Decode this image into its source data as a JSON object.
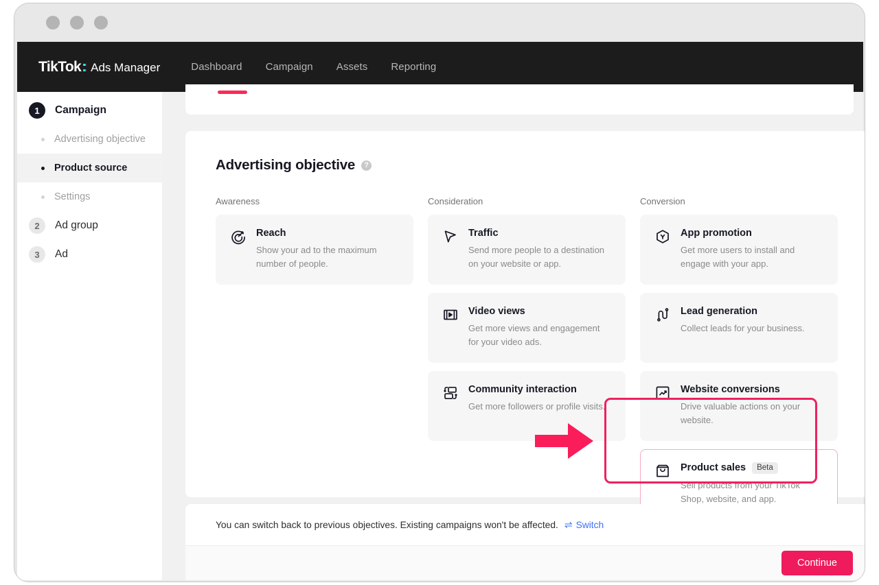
{
  "window": {
    "dots": [
      "close-dot",
      "minimize-dot",
      "maximize-dot"
    ]
  },
  "header": {
    "logo": "TikTok",
    "logo_colon": ":",
    "logo_suffix": "Ads Manager",
    "nav": [
      {
        "label": "Dashboard"
      },
      {
        "label": "Campaign"
      },
      {
        "label": "Assets"
      },
      {
        "label": "Reporting"
      }
    ]
  },
  "sidebar": {
    "items": [
      {
        "type": "step",
        "badge": "1",
        "label": "Campaign",
        "state": "active"
      },
      {
        "type": "sub",
        "label": "Advertising objective",
        "state": "off"
      },
      {
        "type": "sub",
        "label": "Product source",
        "state": "on"
      },
      {
        "type": "sub",
        "label": "Settings",
        "state": "off"
      },
      {
        "type": "step",
        "badge": "2",
        "label": "Ad group",
        "state": "idle"
      },
      {
        "type": "step",
        "badge": "3",
        "label": "Ad",
        "state": "idle"
      }
    ]
  },
  "main": {
    "title": "Advertising objective",
    "help_icon": "?",
    "columns": [
      {
        "label": "Awareness",
        "cards": [
          {
            "icon": "target-dart-icon",
            "title": "Reach",
            "badge": "",
            "desc": "Show your ad to the maximum number of people.",
            "highlighted": false
          }
        ]
      },
      {
        "label": "Consideration",
        "cards": [
          {
            "icon": "cursor-arrow-icon",
            "title": "Traffic",
            "badge": "",
            "desc": "Send more people to a destination on your website or app.",
            "highlighted": false
          },
          {
            "icon": "film-play-icon",
            "title": "Video views",
            "badge": "",
            "desc": "Get more views and engagement for your video ads.",
            "highlighted": false
          },
          {
            "icon": "community-exchange-icon",
            "title": "Community interaction",
            "badge": "",
            "desc": "Get more followers or profile visits.",
            "highlighted": false
          }
        ]
      },
      {
        "label": "Conversion",
        "cards": [
          {
            "icon": "app-hexagon-icon",
            "title": "App promotion",
            "badge": "",
            "desc": "Get more users to install and engage with your app.",
            "highlighted": false
          },
          {
            "icon": "magnet-lead-icon",
            "title": "Lead generation",
            "badge": "",
            "desc": "Collect leads for your business.",
            "highlighted": false
          },
          {
            "icon": "trend-arrow-box-icon",
            "title": "Website conversions",
            "badge": "",
            "desc": "Drive valuable actions on your website.",
            "highlighted": false
          },
          {
            "icon": "shopping-bag-icon",
            "title": "Product sales",
            "badge": "Beta",
            "desc": "Sell products from your TikTok Shop, website, and app.",
            "highlighted": true
          }
        ]
      }
    ]
  },
  "notice": {
    "text": "You can switch back to previous objectives. Existing campaigns won't be affected.",
    "switch_arrows": "⇌",
    "switch_label": "Switch"
  },
  "footer": {
    "continue_label": "Continue"
  },
  "colors": {
    "brand_pink": "#ef1b5c",
    "highlight_border": "#ef2060",
    "annotation_arrow": "#fa1d5a",
    "logo_cyan": "#25f4ee",
    "link_blue": "#3a6ff7",
    "nav_bg": "#1c1c1c",
    "card_bg": "#f6f6f6"
  }
}
